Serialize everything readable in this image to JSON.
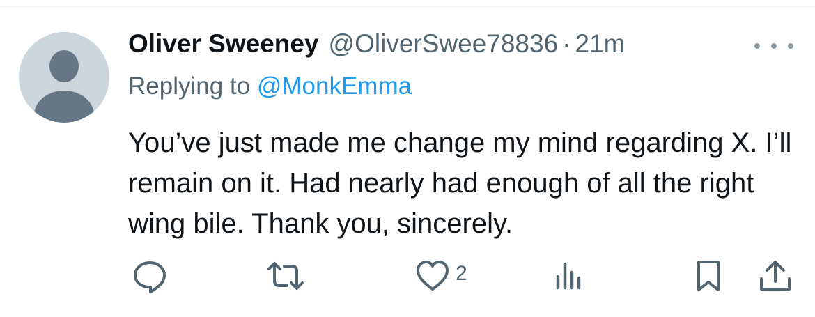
{
  "tweet": {
    "author_name": "Oliver Sweeney",
    "handle": "@OliverSwee78836",
    "separator": "·",
    "time": "21m",
    "replying_prefix": "Replying to ",
    "replying_to": "@MonkEmma",
    "text": "You’ve just made me change my mind regarding X. I’ll remain on it. Had nearly had enough of all the right wing bile. Thank you, sincerely."
  },
  "actions": {
    "reply_icon": "reply-icon",
    "retweet_icon": "retweet-icon",
    "like_icon": "heart-icon",
    "like_count": "2",
    "views_icon": "analytics-icon",
    "bookmark_icon": "bookmark-icon",
    "share_icon": "share-icon"
  },
  "colors": {
    "text": "#0f1419",
    "secondary": "#536471",
    "link": "#1d9bf0",
    "avatar_bg": "#ccd6dd"
  }
}
